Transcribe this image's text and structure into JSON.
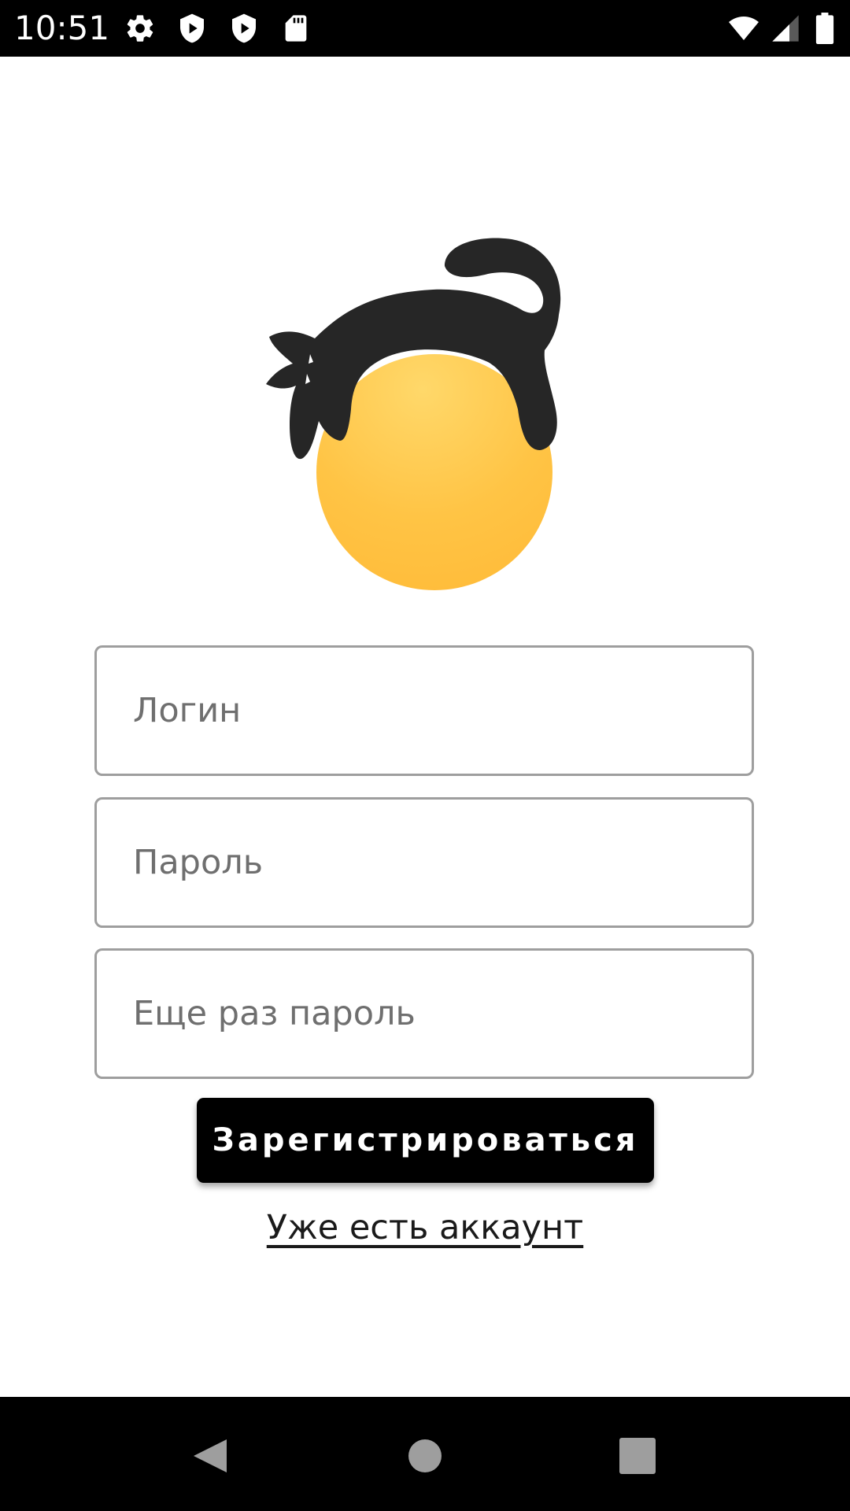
{
  "status_bar": {
    "time": "10:51",
    "left_icons": [
      "gear-icon",
      "shield-play-icon",
      "shield-play-icon",
      "sd-card-icon"
    ],
    "right_icons": [
      "wifi-icon",
      "cellular-signal-icon",
      "battery-icon"
    ]
  },
  "logo": {
    "icon": "cat-on-sun-logo",
    "colors": {
      "cat": "#262626",
      "sun": "#FFC542"
    }
  },
  "form": {
    "login_placeholder": "Логин",
    "password_placeholder": "Пароль",
    "repeat_password_placeholder": "Еще раз пароль",
    "login_value": "",
    "password_value": "",
    "repeat_password_value": ""
  },
  "actions": {
    "register_label": "Зарегистрироваться",
    "have_account_label": "Уже есть аккаунт"
  },
  "nav_bar": {
    "buttons": [
      "back-icon",
      "home-icon",
      "recents-icon"
    ]
  }
}
